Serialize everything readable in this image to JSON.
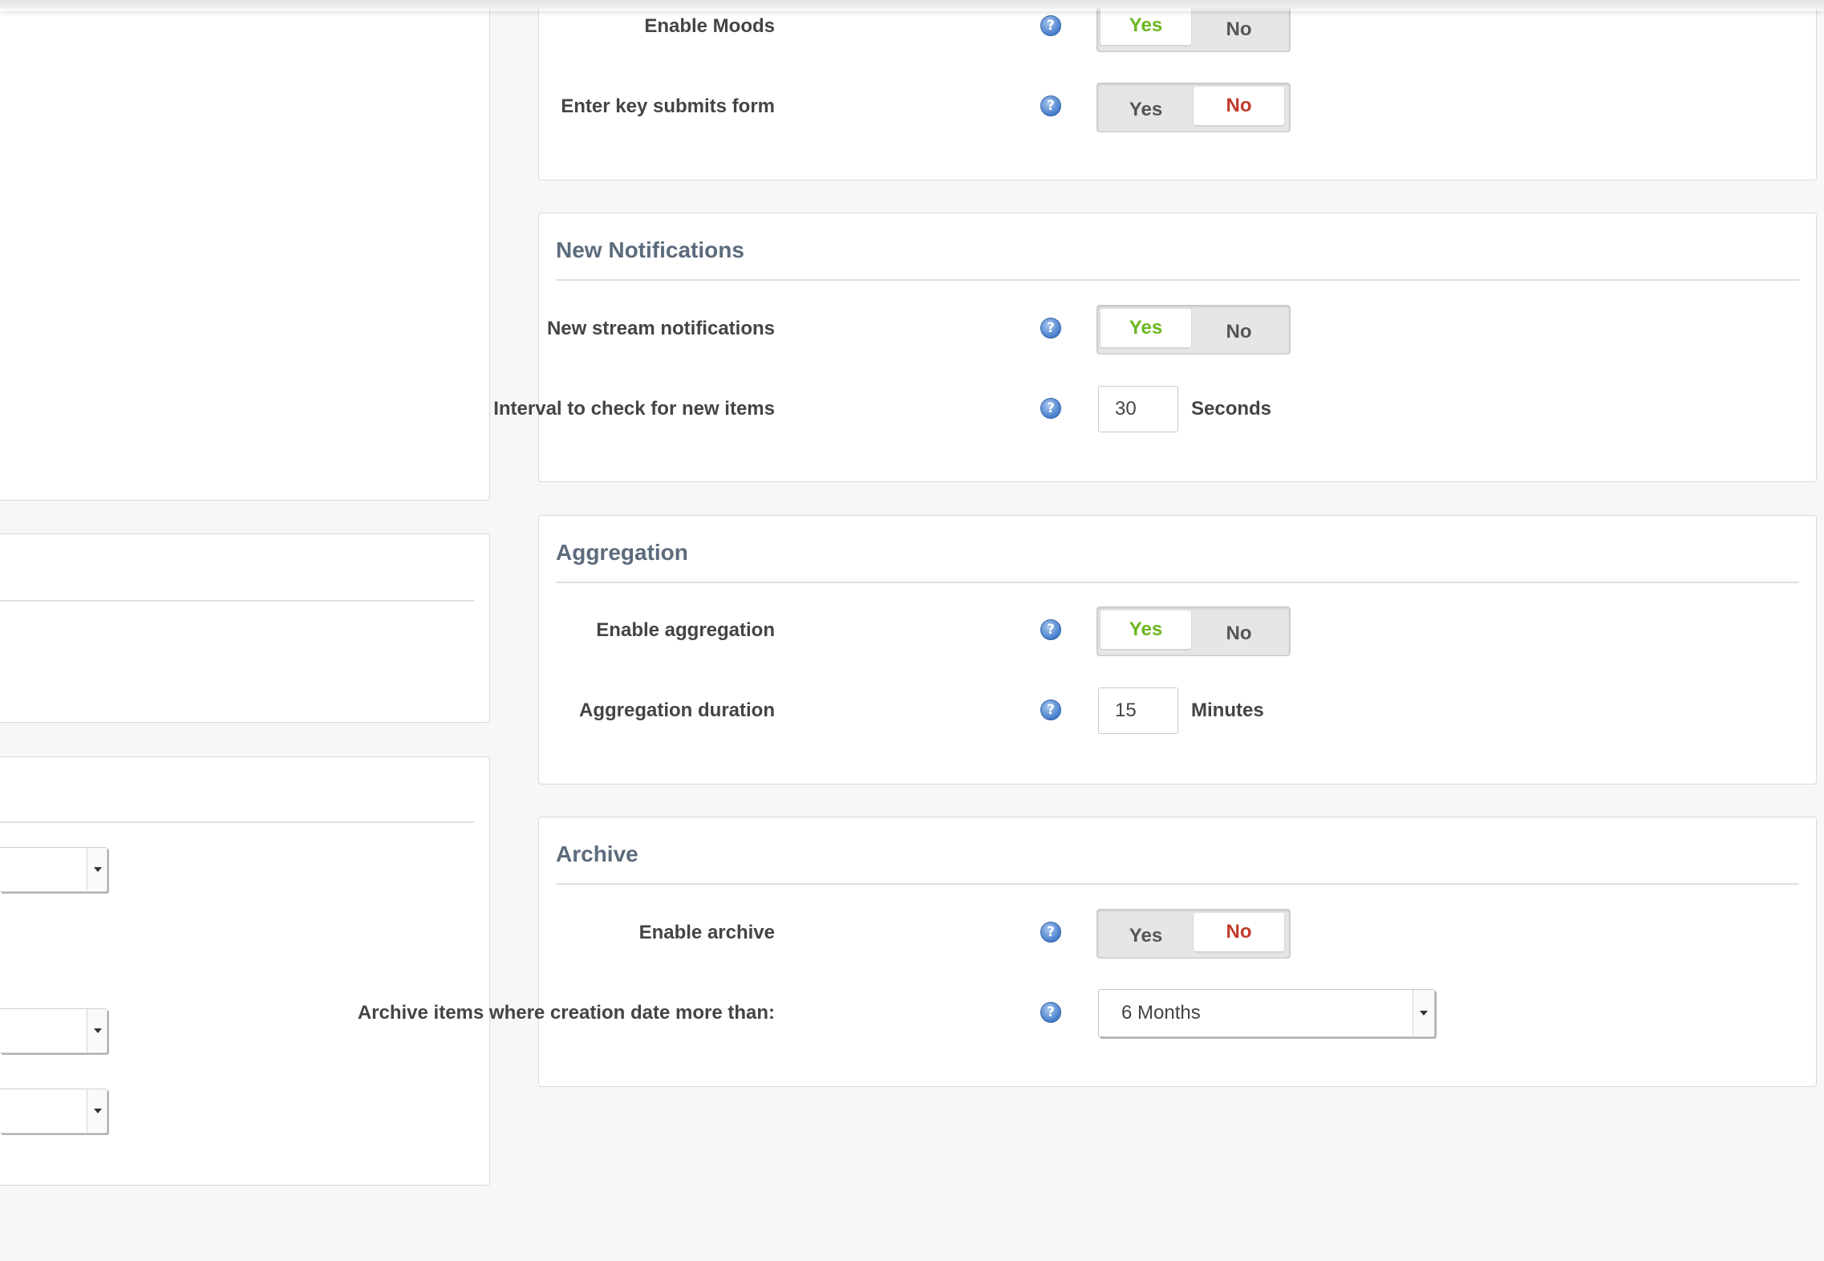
{
  "general": {
    "moods": {
      "label": "Enable Moods",
      "yes": "Yes",
      "no": "No",
      "value": "Yes"
    },
    "enter_submit": {
      "label": "Enter key submits form",
      "yes": "Yes",
      "no": "No",
      "value": "No"
    }
  },
  "notifications": {
    "title": "New Notifications",
    "stream": {
      "label": "New stream notifications",
      "yes": "Yes",
      "no": "No",
      "value": "Yes"
    },
    "interval": {
      "label": "Interval to check for new items",
      "value": "30",
      "unit": "Seconds"
    }
  },
  "aggregation": {
    "title": "Aggregation",
    "enable": {
      "label": "Enable aggregation",
      "yes": "Yes",
      "no": "No",
      "value": "Yes"
    },
    "duration": {
      "label": "Aggregation duration",
      "value": "15",
      "unit": "Minutes"
    }
  },
  "archive": {
    "title": "Archive",
    "enable": {
      "label": "Enable archive",
      "yes": "Yes",
      "no": "No",
      "value": "No"
    },
    "older_than": {
      "label": "Archive items where creation date more than:",
      "selected": "6 Months"
    }
  },
  "icons": {
    "help": "help-icon",
    "dropdown": "chevron-down-icon"
  },
  "help_glyph": "?",
  "colors": {
    "yes_active": "#6bb720",
    "no_active": "#c0392b",
    "section_title": "#5c6b7c",
    "background": "#f7f7f7"
  }
}
